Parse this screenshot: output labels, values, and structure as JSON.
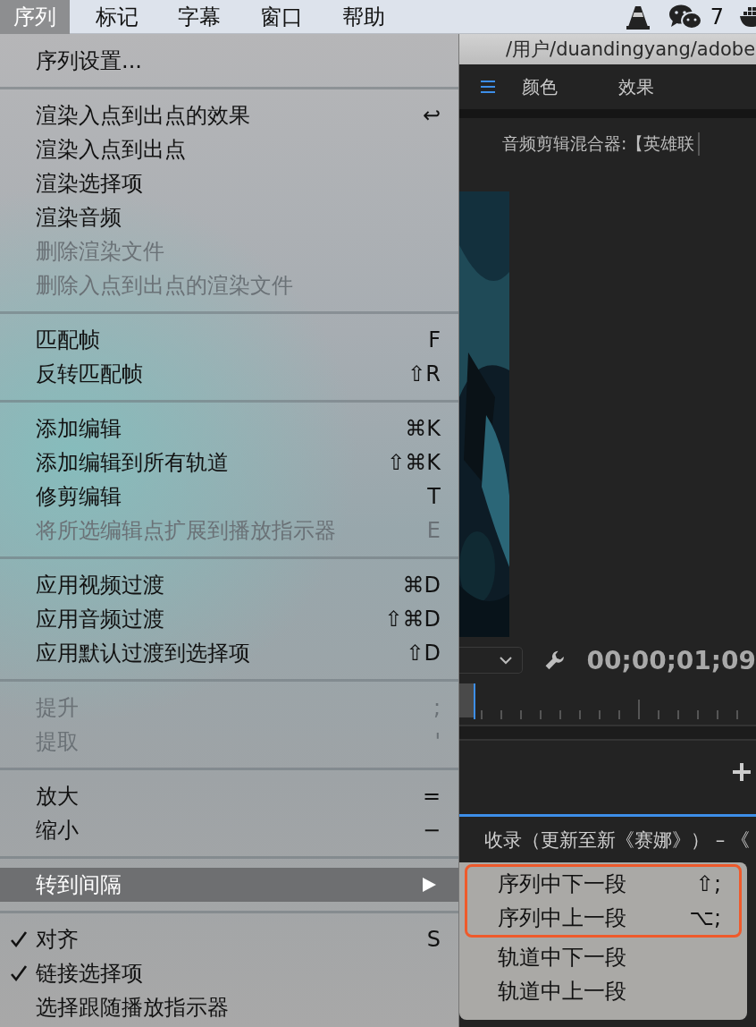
{
  "menu_bar": {
    "items": [
      {
        "label": "序列",
        "selected": true
      },
      {
        "label": "标记",
        "selected": false
      },
      {
        "label": "字幕",
        "selected": false
      },
      {
        "label": "窗口",
        "selected": false
      },
      {
        "label": "帮助",
        "selected": false
      }
    ],
    "badge_count": "7"
  },
  "menu": [
    {
      "kind": "item",
      "label": "序列设置...",
      "disabled": false,
      "checked": false
    },
    {
      "kind": "separator"
    },
    {
      "kind": "item",
      "label": "渲染入点到出点的效果",
      "shortcut": "↩",
      "disabled": false,
      "checked": false
    },
    {
      "kind": "item",
      "label": "渲染入点到出点",
      "disabled": false,
      "checked": false
    },
    {
      "kind": "item",
      "label": "渲染选择项",
      "disabled": false,
      "checked": false
    },
    {
      "kind": "item",
      "label": "渲染音频",
      "disabled": false,
      "checked": false
    },
    {
      "kind": "item",
      "label": "删除渲染文件",
      "disabled": true,
      "checked": false
    },
    {
      "kind": "item",
      "label": "删除入点到出点的渲染文件",
      "disabled": true,
      "checked": false
    },
    {
      "kind": "separator"
    },
    {
      "kind": "item",
      "label": "匹配帧",
      "shortcut": "F",
      "disabled": false,
      "checked": false
    },
    {
      "kind": "item",
      "label": "反转匹配帧",
      "shortcut": "⇧R",
      "disabled": false,
      "checked": false
    },
    {
      "kind": "separator"
    },
    {
      "kind": "item",
      "label": "添加编辑",
      "shortcut": "⌘K",
      "disabled": false,
      "checked": false
    },
    {
      "kind": "item",
      "label": "添加编辑到所有轨道",
      "shortcut": "⇧⌘K",
      "disabled": false,
      "checked": false
    },
    {
      "kind": "item",
      "label": "修剪编辑",
      "shortcut": "T",
      "disabled": false,
      "checked": false
    },
    {
      "kind": "item",
      "label": "将所选编辑点扩展到播放指示器",
      "shortcut": "E",
      "disabled": true,
      "checked": false
    },
    {
      "kind": "separator"
    },
    {
      "kind": "item",
      "label": "应用视频过渡",
      "shortcut": "⌘D",
      "disabled": false,
      "checked": false
    },
    {
      "kind": "item",
      "label": "应用音频过渡",
      "shortcut": "⇧⌘D",
      "disabled": false,
      "checked": false
    },
    {
      "kind": "item",
      "label": "应用默认过渡到选择项",
      "shortcut": "⇧D",
      "disabled": false,
      "checked": false
    },
    {
      "kind": "separator"
    },
    {
      "kind": "item",
      "label": "提升",
      "shortcut": ";",
      "disabled": true,
      "checked": false
    },
    {
      "kind": "item",
      "label": "提取",
      "shortcut": "'",
      "disabled": true,
      "checked": false
    },
    {
      "kind": "separator"
    },
    {
      "kind": "item",
      "label": "放大",
      "shortcut": "=",
      "disabled": false,
      "checked": false
    },
    {
      "kind": "item",
      "label": "缩小",
      "shortcut": "−",
      "disabled": false,
      "checked": false
    },
    {
      "kind": "separator"
    },
    {
      "kind": "submenu",
      "label": "转到间隔",
      "selected": true,
      "submenu": [
        {
          "label": "序列中下一段",
          "shortcut": "⇧;",
          "annotated": true
        },
        {
          "label": "序列中上一段",
          "shortcut": "⌥;",
          "annotated": true
        },
        {
          "label": "轨道中下一段",
          "annotated": false
        },
        {
          "label": "轨道中上一段",
          "annotated": false
        }
      ]
    },
    {
      "kind": "separator"
    },
    {
      "kind": "item",
      "label": "对齐",
      "shortcut": "S",
      "disabled": false,
      "checked": true
    },
    {
      "kind": "item",
      "label": "链接选择项",
      "disabled": false,
      "checked": true
    },
    {
      "kind": "item",
      "label": "选择跟随播放指示器",
      "disabled": false,
      "checked": false
    }
  ],
  "app": {
    "path": "/用户/duandingyang/adobe",
    "tabs": [
      {
        "label": "颜色"
      },
      {
        "label": "效果"
      }
    ],
    "mixer_label": "音频剪辑混合器:【英雄联",
    "timecode": "00;00;01;09",
    "sequence_title": "收录（更新至新《赛娜》） – 《"
  }
}
